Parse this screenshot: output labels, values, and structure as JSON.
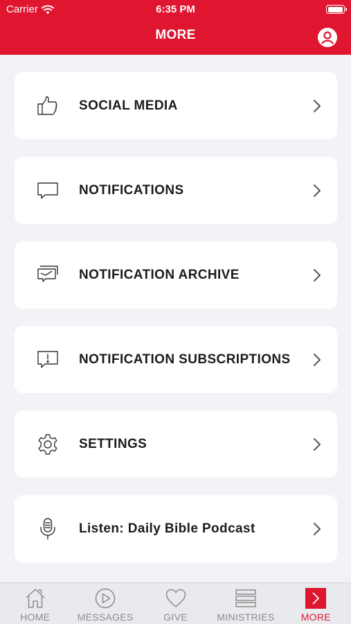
{
  "status_bar": {
    "carrier": "Carrier",
    "time": "6:35 PM"
  },
  "header": {
    "title": "MORE",
    "profile_icon": "user-circle-icon"
  },
  "colors": {
    "brand": "#e0152f",
    "background": "#f2f3f7",
    "card": "#ffffff",
    "tab_inactive": "#8c8c8c"
  },
  "menu": {
    "items": [
      {
        "label": "SOCIAL MEDIA",
        "icon": "thumbs-up-icon"
      },
      {
        "label": "NOTIFICATIONS",
        "icon": "chat-bubble-icon"
      },
      {
        "label": "NOTIFICATION ARCHIVE",
        "icon": "archive-messages-icon"
      },
      {
        "label": "NOTIFICATION SUBSCRIPTIONS",
        "icon": "alert-bubble-icon"
      },
      {
        "label": "SETTINGS",
        "icon": "gear-icon"
      },
      {
        "label": "Listen: Daily Bible Podcast",
        "icon": "microphone-icon"
      }
    ]
  },
  "tabbar": {
    "items": [
      {
        "label": "HOME",
        "icon": "home-icon"
      },
      {
        "label": "MESSAGES",
        "icon": "play-circle-icon"
      },
      {
        "label": "GIVE",
        "icon": "heart-icon"
      },
      {
        "label": "MINISTRIES",
        "icon": "menu-lines-icon"
      },
      {
        "label": "MORE",
        "icon": "chevron-right-icon",
        "active": true
      }
    ]
  }
}
